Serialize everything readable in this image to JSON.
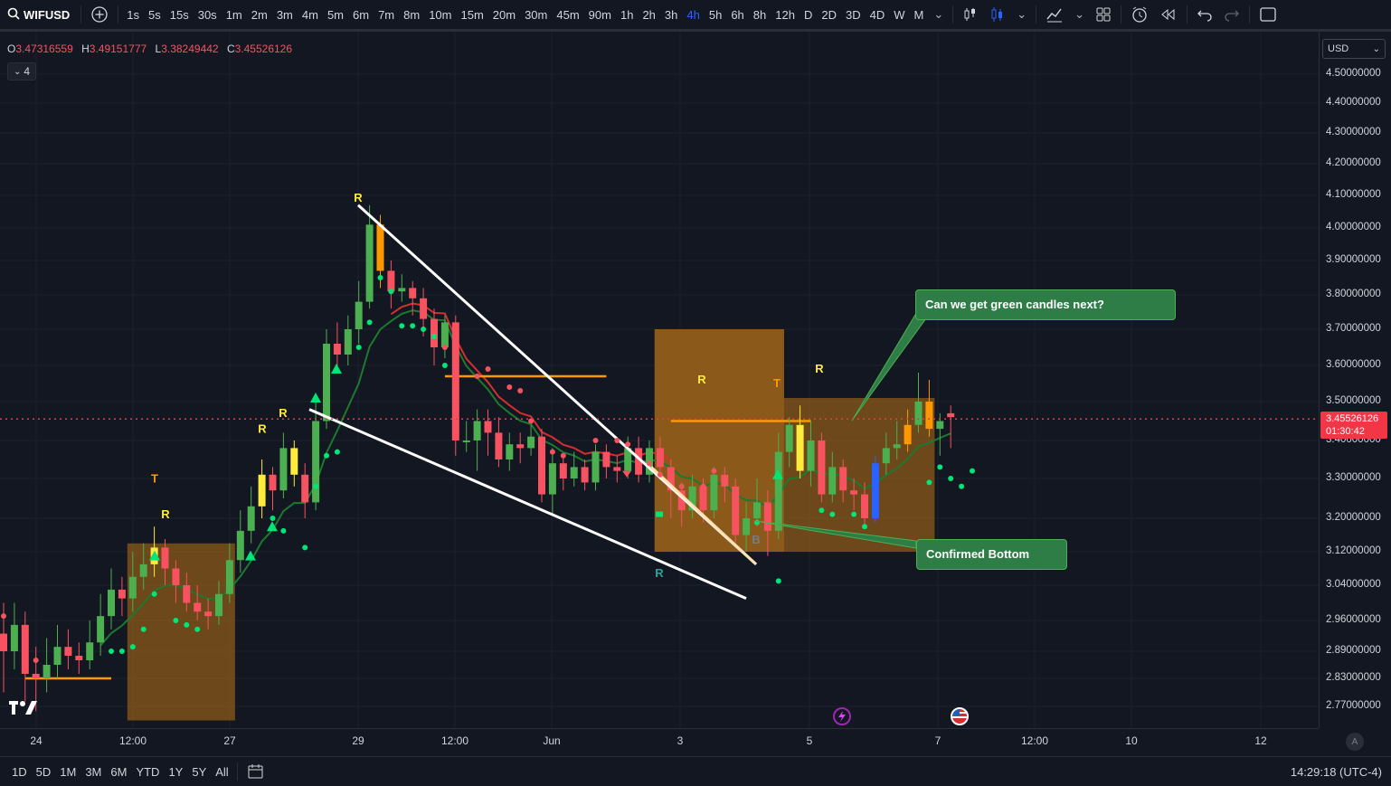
{
  "symbol": "WIFUSD",
  "timeframes": [
    "1s",
    "5s",
    "15s",
    "30s",
    "1m",
    "2m",
    "3m",
    "4m",
    "5m",
    "6m",
    "7m",
    "8m",
    "10m",
    "15m",
    "20m",
    "30m",
    "45m",
    "90m",
    "1h",
    "2h",
    "3h",
    "4h",
    "5h",
    "6h",
    "8h",
    "12h",
    "D",
    "2D",
    "3D",
    "4D",
    "W",
    "M"
  ],
  "active_timeframe": "4h",
  "ohlc": {
    "o_label": "O",
    "o": "3.47316559",
    "h_label": "H",
    "h": "3.49151777",
    "l_label": "L",
    "l": "3.38249442",
    "c_label": "C",
    "c": "3.45526126"
  },
  "indicator_count": "4",
  "currency": "USD",
  "price_ticks": [
    "4.50000000",
    "4.40000000",
    "4.30000000",
    "4.20000000",
    "4.10000000",
    "4.00000000",
    "3.90000000",
    "3.80000000",
    "3.70000000",
    "3.60000000",
    "3.50000000",
    "3.40000000",
    "3.30000000",
    "3.20000000",
    "3.12000000",
    "3.04000000",
    "2.96000000",
    "2.89000000",
    "2.83000000",
    "2.77000000"
  ],
  "last_price": "3.45526126",
  "countdown": "01:30:42",
  "time_ticks": [
    "24",
    "12:00",
    "27",
    "29",
    "12:00",
    "Jun",
    "3",
    "5",
    "7",
    "12:00",
    "10",
    "12"
  ],
  "ranges": [
    "1D",
    "5D",
    "1M",
    "3M",
    "6M",
    "YTD",
    "1Y",
    "5Y",
    "All"
  ],
  "clock": "14:29:18 (UTC-4)",
  "callouts": {
    "green_candles": "Can we get green candles next?",
    "bottom": "Confirmed Bottom"
  },
  "signal_letters": {
    "R": "R",
    "T": "T",
    "B": "B"
  },
  "colors": {
    "up": "#4caf50",
    "down": "#f7525f",
    "orange": "#ff9800",
    "yellow": "#ffeb3b",
    "band": "#8b5a1a",
    "ema": "#1b7a2e",
    "callout": "#2e7d46",
    "blue": "#2962ff"
  },
  "chart_data": {
    "type": "candlestick",
    "series": [
      {
        "name": "WIFUSD",
        "values": [
          [
            2.93,
            2.89,
            3.0,
            2.8
          ],
          [
            2.89,
            2.95,
            3.0,
            2.85
          ],
          [
            2.95,
            2.84,
            2.98,
            2.78
          ],
          [
            2.84,
            2.83,
            2.9,
            2.76
          ],
          [
            2.83,
            2.86,
            2.92,
            2.8
          ],
          [
            2.86,
            2.9,
            2.95,
            2.83
          ],
          [
            2.9,
            2.88,
            2.94,
            2.85
          ],
          [
            2.88,
            2.87,
            2.91,
            2.84
          ],
          [
            2.87,
            2.91,
            2.96,
            2.85
          ],
          [
            2.91,
            2.97,
            3.02,
            2.88
          ],
          [
            2.97,
            3.03,
            3.08,
            2.94
          ],
          [
            3.03,
            3.01,
            3.06,
            2.97
          ],
          [
            3.01,
            3.06,
            3.12,
            2.98
          ],
          [
            3.06,
            3.09,
            3.14,
            3.03
          ],
          [
            3.09,
            3.13,
            3.18,
            3.06
          ],
          [
            3.13,
            3.08,
            3.15,
            3.04
          ],
          [
            3.08,
            3.04,
            3.1,
            3.0
          ],
          [
            3.04,
            3.0,
            3.07,
            2.98
          ],
          [
            3.0,
            2.98,
            3.04,
            2.96
          ],
          [
            2.98,
            2.97,
            3.01,
            2.94
          ],
          [
            2.97,
            3.02,
            3.05,
            2.95
          ],
          [
            3.02,
            3.1,
            3.14,
            3.0
          ],
          [
            3.1,
            3.17,
            3.22,
            3.07
          ],
          [
            3.17,
            3.23,
            3.28,
            3.14
          ],
          [
            3.23,
            3.31,
            3.35,
            3.2
          ],
          [
            3.31,
            3.27,
            3.33,
            3.22
          ],
          [
            3.27,
            3.38,
            3.42,
            3.25
          ],
          [
            3.38,
            3.31,
            3.4,
            3.28
          ],
          [
            3.31,
            3.24,
            3.34,
            3.2
          ],
          [
            3.24,
            3.45,
            3.5,
            3.22
          ],
          [
            3.45,
            3.66,
            3.7,
            3.43
          ],
          [
            3.66,
            3.63,
            3.72,
            3.58
          ],
          [
            3.63,
            3.7,
            3.74,
            3.6
          ],
          [
            3.7,
            3.78,
            3.84,
            3.66
          ],
          [
            3.78,
            4.01,
            4.07,
            3.76
          ],
          [
            4.01,
            3.87,
            4.04,
            3.82
          ],
          [
            3.87,
            3.81,
            3.9,
            3.76
          ],
          [
            3.81,
            3.82,
            3.86,
            3.78
          ],
          [
            3.82,
            3.79,
            3.84,
            3.74
          ],
          [
            3.79,
            3.73,
            3.82,
            3.68
          ],
          [
            3.73,
            3.65,
            3.76,
            3.6
          ],
          [
            3.65,
            3.72,
            3.74,
            3.62
          ],
          [
            3.72,
            3.4,
            3.74,
            3.36
          ],
          [
            3.4,
            3.4,
            3.45,
            3.37
          ],
          [
            3.4,
            3.45,
            3.48,
            3.32
          ],
          [
            3.45,
            3.42,
            3.48,
            3.36
          ],
          [
            3.42,
            3.35,
            3.46,
            3.33
          ],
          [
            3.35,
            3.39,
            3.42,
            3.32
          ],
          [
            3.39,
            3.38,
            3.42,
            3.34
          ],
          [
            3.38,
            3.41,
            3.44,
            3.36
          ],
          [
            3.41,
            3.26,
            3.43,
            3.24
          ],
          [
            3.26,
            3.34,
            3.38,
            3.21
          ],
          [
            3.34,
            3.3,
            3.36,
            3.27
          ],
          [
            3.3,
            3.33,
            3.37,
            3.28
          ],
          [
            3.33,
            3.29,
            3.35,
            3.27
          ],
          [
            3.29,
            3.37,
            3.39,
            3.27
          ],
          [
            3.37,
            3.33,
            3.39,
            3.3
          ],
          [
            3.33,
            3.32,
            3.36,
            3.29
          ],
          [
            3.32,
            3.38,
            3.41,
            3.3
          ],
          [
            3.38,
            3.31,
            3.41,
            3.29
          ],
          [
            3.31,
            3.38,
            3.4,
            3.29
          ],
          [
            3.38,
            3.33,
            3.41,
            3.3
          ],
          [
            3.33,
            3.27,
            3.35,
            3.2
          ],
          [
            3.27,
            3.22,
            3.29,
            3.18
          ],
          [
            3.22,
            3.28,
            3.31,
            3.2
          ],
          [
            3.28,
            3.22,
            3.3,
            3.19
          ],
          [
            3.22,
            3.31,
            3.33,
            3.2
          ],
          [
            3.31,
            3.28,
            3.33,
            3.24
          ],
          [
            3.28,
            3.16,
            3.3,
            3.13
          ],
          [
            3.16,
            3.2,
            3.24,
            3.12
          ],
          [
            3.2,
            3.24,
            3.3,
            3.18
          ],
          [
            3.24,
            3.17,
            3.27,
            3.11
          ],
          [
            3.17,
            3.37,
            3.42,
            3.15
          ],
          [
            3.37,
            3.44,
            3.46,
            3.33
          ],
          [
            3.44,
            3.32,
            3.49,
            3.3
          ],
          [
            3.32,
            3.4,
            3.45,
            3.28
          ],
          [
            3.4,
            3.26,
            3.42,
            3.24
          ],
          [
            3.26,
            3.33,
            3.37,
            3.24
          ],
          [
            3.33,
            3.27,
            3.35,
            3.24
          ],
          [
            3.27,
            3.26,
            3.3,
            3.22
          ],
          [
            3.26,
            3.2,
            3.29,
            3.18
          ],
          [
            3.2,
            3.34,
            3.36,
            3.19
          ],
          [
            3.34,
            3.38,
            3.42,
            3.31
          ],
          [
            3.38,
            3.39,
            3.45,
            3.35
          ],
          [
            3.39,
            3.44,
            3.48,
            3.37
          ],
          [
            3.44,
            3.5,
            3.58,
            3.42
          ],
          [
            3.5,
            3.43,
            3.56,
            3.41
          ],
          [
            3.43,
            3.45,
            3.47,
            3.36
          ],
          [
            3.47,
            3.46,
            3.49,
            3.38
          ]
        ]
      }
    ]
  }
}
